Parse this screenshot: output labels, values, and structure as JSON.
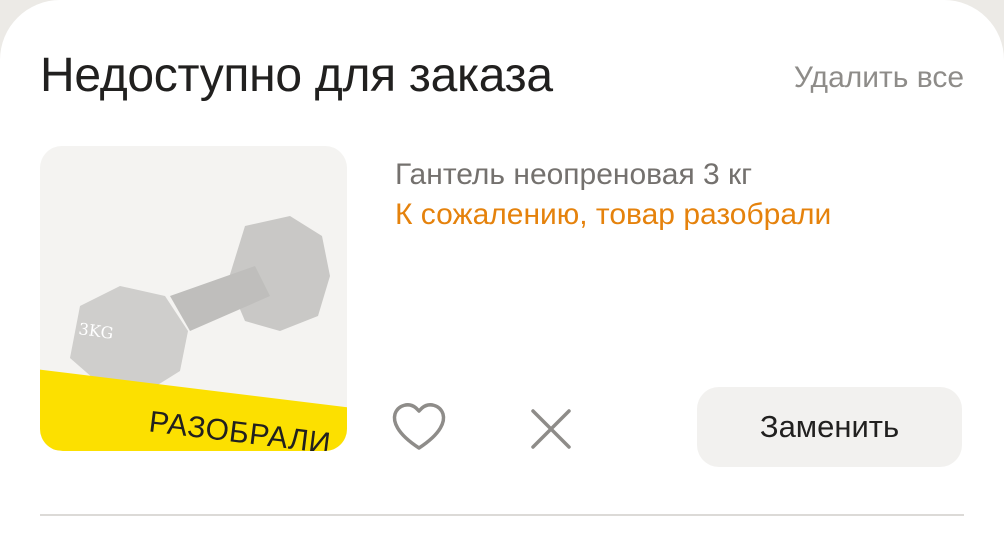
{
  "section": {
    "title": "Недоступно для заказа",
    "delete_all_label": "Удалить все"
  },
  "item": {
    "badge": "РАЗОБРАЛИ",
    "weight_mark": "3KG",
    "name": "Гантель неопреновая 3 кг",
    "status": "К сожалению, товар разобрали",
    "favorite_icon": "heart-icon",
    "remove_icon": "close-icon",
    "replace_label": "Заменить"
  },
  "colors": {
    "badge_yellow": "#fce000",
    "status_orange": "#e5820c",
    "text_primary": "#21201f",
    "text_secondary": "#8e8c89"
  }
}
